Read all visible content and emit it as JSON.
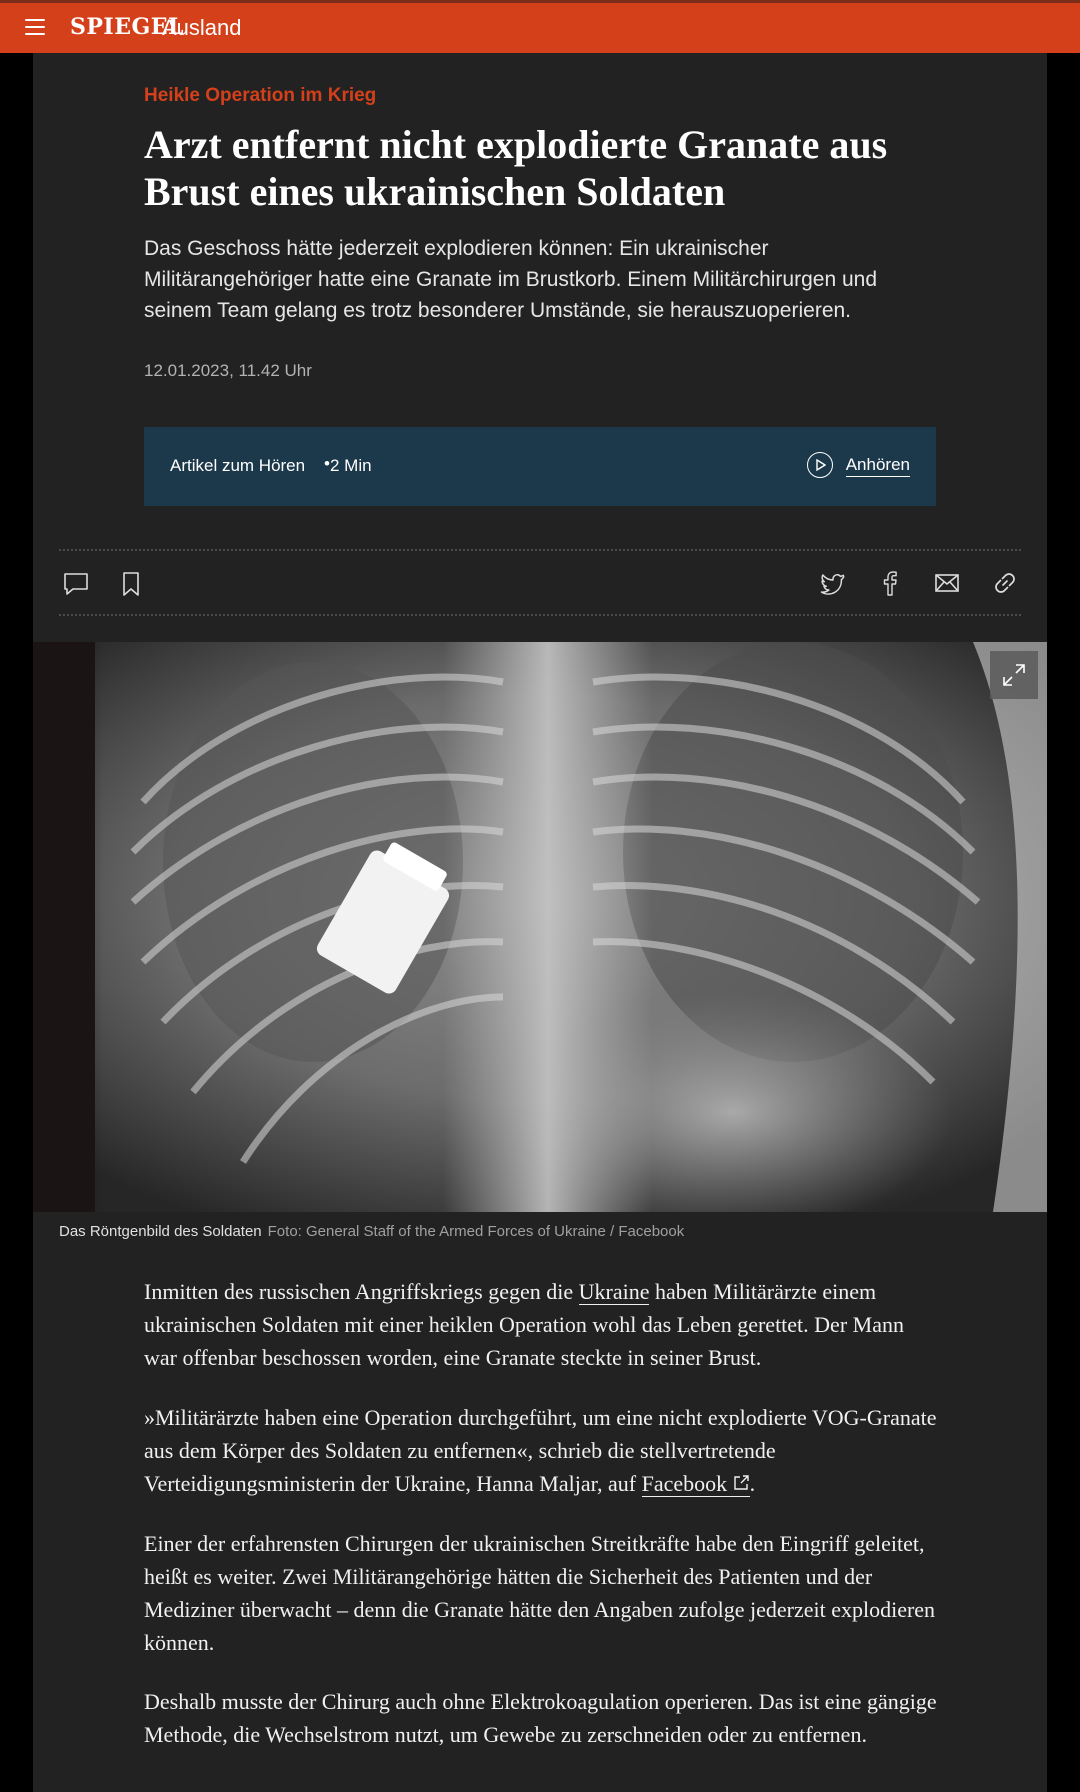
{
  "header": {
    "logo": "SPIEGEL",
    "section": "Ausland",
    "brand_color": "#d4401a"
  },
  "article": {
    "kicker": "Heikle Operation im Krieg",
    "headline": "Arzt entfernt nicht explodierte Granate aus Brust eines ukrainischen Soldaten",
    "lead": "Das Geschoss hätte jederzeit explodieren können: Ein ukrainischer Militärangehöriger hatte eine Granate im Brustkorb. Einem Militärchirurgen und seinem Team gelang es trotz besonderer Umstände, sie herauszuoperieren.",
    "date": "12.01.2023, 11.42 Uhr",
    "audio": {
      "label": "Artikel zum Hören",
      "separator": "•",
      "duration": "2 Min",
      "listen_label": "Anhören"
    },
    "toolbar_icons": [
      "comment-icon",
      "bookmark-icon",
      "twitter-icon",
      "facebook-icon",
      "mail-icon",
      "link-icon"
    ],
    "image": {
      "caption": "Das Röntgenbild des Soldaten",
      "credit": "Foto: General Staff of the Armed Forces of Ukraine / Facebook"
    },
    "paragraphs": {
      "p1_before": "Inmitten des russischen Angriffskriegs gegen die ",
      "p1_link": "Ukraine",
      "p1_after": " haben Militärärzte einem ukrainischen Soldaten mit einer heiklen Operation wohl das Leben gerettet. Der Mann war offenbar beschossen worden, eine Granate steckte in seiner Brust.",
      "p2_before": "»Militärärzte haben eine Operation durchgeführt, um eine nicht explodierte VOG-Granate aus dem Körper des Soldaten zu entfernen«, schrieb die stellvertretende Verteidigungsministerin der Ukraine, Hanna Maljar, auf ",
      "p2_link": "Facebook",
      "p2_after": ".",
      "p3": "Einer der erfahrensten Chirurgen der ukrainischen Streitkräfte habe den Eingriff geleitet, heißt es weiter. Zwei Militärangehörige hätten die Sicherheit des Patienten und der Mediziner überwacht – denn die Granate hätte den Angaben zufolge jederzeit explodieren können.",
      "p4": "Deshalb musste der Chirurg auch ohne Elektrokoagulation operieren. Das ist eine gängige Methode, die Wechselstrom nutzt, um Gewebe zu zerschneiden oder zu entfernen."
    },
    "audio_box_color": "#1c394b"
  }
}
